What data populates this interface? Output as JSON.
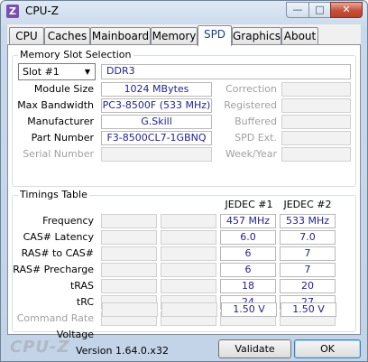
{
  "window": {
    "title": "CPU-Z",
    "icon": "Z"
  },
  "controls": {
    "minimize": "—",
    "maximize": "□",
    "close": "✕"
  },
  "tabs": [
    "CPU",
    "Caches",
    "Mainboard",
    "Memory",
    "SPD",
    "Graphics",
    "About"
  ],
  "active_tab": "SPD",
  "slot_section": {
    "title": "Memory Slot Selection",
    "slot_value": "Slot #1",
    "memory_type": "DDR3",
    "rows": [
      {
        "label": "Module Size",
        "value": "1024 MBytes",
        "right_label": "Correction",
        "right_value": ""
      },
      {
        "label": "Max Bandwidth",
        "value": "PC3-8500F (533 MHz)",
        "right_label": "Registered",
        "right_value": ""
      },
      {
        "label": "Manufacturer",
        "value": "G.Skill",
        "right_label": "Buffered",
        "right_value": ""
      },
      {
        "label": "Part Number",
        "value": "F3-8500CL7-1GBNQ",
        "right_label": "SPD Ext.",
        "right_value": ""
      },
      {
        "label": "Serial Number",
        "value": "",
        "right_label": "Week/Year",
        "right_value": ""
      }
    ]
  },
  "timings": {
    "title": "Timings Table",
    "columns": [
      "",
      "",
      "JEDEC #1",
      "JEDEC #2"
    ],
    "rows": [
      {
        "label": "Frequency",
        "values": [
          "",
          "",
          "457 MHz",
          "533 MHz"
        ]
      },
      {
        "label": "CAS# Latency",
        "values": [
          "",
          "",
          "6.0",
          "7.0"
        ]
      },
      {
        "label": "RAS# to CAS#",
        "values": [
          "",
          "",
          "6",
          "7"
        ]
      },
      {
        "label": "RAS# Precharge",
        "values": [
          "",
          "",
          "6",
          "7"
        ]
      },
      {
        "label": "tRAS",
        "values": [
          "",
          "",
          "18",
          "20"
        ]
      },
      {
        "label": "tRC",
        "values": [
          "",
          "",
          "24",
          "27"
        ]
      },
      {
        "label": "Command Rate",
        "values": [
          "",
          "",
          "",
          ""
        ]
      },
      {
        "label": "Voltage",
        "values": [
          "",
          "",
          "1.50 V",
          "1.50 V"
        ]
      }
    ]
  },
  "footer": {
    "logo": "CPU-Z",
    "version": "Version 1.64.0.x32",
    "validate": "Validate",
    "ok": "OK"
  }
}
